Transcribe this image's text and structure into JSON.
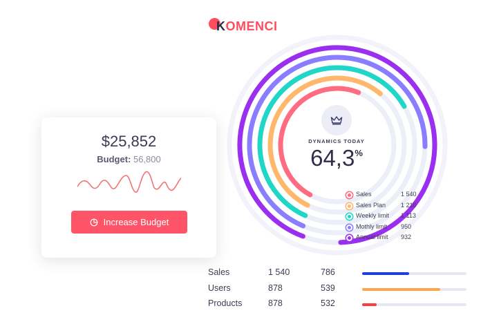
{
  "logo": {
    "first_letter": "K",
    "rest": "OMENCI",
    "color": "#ff4d5e"
  },
  "budget_card": {
    "amount": "$25,852",
    "budget_label": "Budget:",
    "budget_value": "56,800",
    "button_label": "Increase Budget",
    "button_icon": "pie-chart-icon"
  },
  "dynamics": {
    "label": "DYNAMICS TODAY",
    "value": "64,3",
    "unit": "%",
    "icon": "crown-icon"
  },
  "legend": [
    {
      "name": "Sales",
      "value": "1 540",
      "color": "#ff6b81"
    },
    {
      "name": "Sales Plan",
      "value": "1 210",
      "color": "#ffb86b"
    },
    {
      "name": "Weekly limit",
      "value": "1 113",
      "color": "#20d6c7"
    },
    {
      "name": "Mothly limit",
      "value": "950",
      "color": "#8a7dff"
    },
    {
      "name": "Annual limit",
      "value": "932",
      "color": "#9b2ff0"
    }
  ],
  "stats": [
    {
      "name": "Sales",
      "v1": "1 540",
      "v2": "786",
      "progress": 0.45,
      "color": "#1d3de6"
    },
    {
      "name": "Users",
      "v1": "878",
      "v2": "539",
      "progress": 0.75,
      "color": "#ffa64d"
    },
    {
      "name": "Products",
      "v1": "878",
      "v2": "532",
      "progress": 0.14,
      "color": "#ff3b3b"
    }
  ]
}
